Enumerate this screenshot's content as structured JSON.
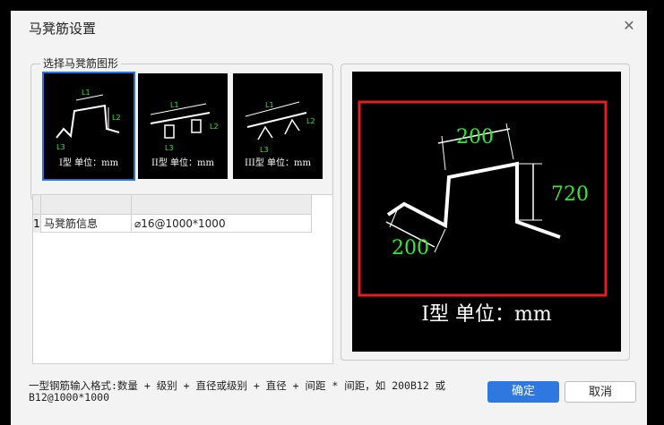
{
  "dialog": {
    "title": "马凳筋设置",
    "close_icon": "close-icon"
  },
  "shape_group": {
    "label": "选择马凳筋图形",
    "shapes": [
      {
        "caption": "I型 单位：mm",
        "selected": true,
        "labels": [
          "L1",
          "L2",
          "L3"
        ]
      },
      {
        "caption": "II型 单位：mm",
        "selected": false,
        "labels": [
          "L1",
          "L2",
          "L3"
        ]
      },
      {
        "caption": "III型 单位：mm",
        "selected": false,
        "labels": [
          "L1",
          "L2",
          "L3"
        ]
      }
    ]
  },
  "table": {
    "columns": [
      "",
      ""
    ],
    "rows": [
      {
        "index": "1",
        "name": "马凳筋信息",
        "value": "⌀16@1000*1000"
      }
    ]
  },
  "preview": {
    "dim_top": "200",
    "dim_right": "720",
    "dim_left": "200",
    "caption": "I型 单位：mm",
    "highlight_color": "#e02020",
    "label_color": "#38e838"
  },
  "footer": {
    "hint": "一型钢筋输入格式:数量 + 级别 + 直径或级别 + 直径 + 间距 * 间距，如 200B12 或 B12@1000*1000"
  },
  "buttons": {
    "ok_label": "确定",
    "cancel_label": "取消"
  }
}
